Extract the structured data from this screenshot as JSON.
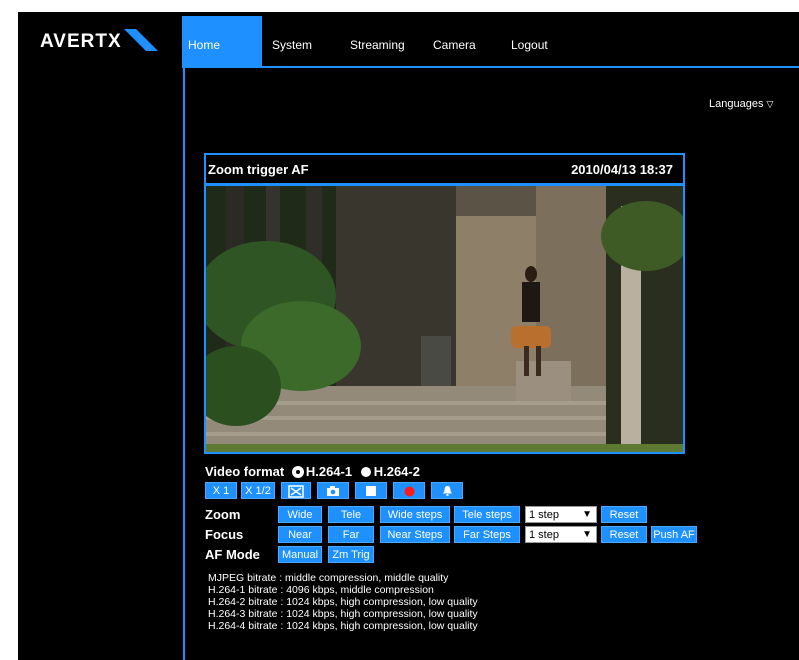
{
  "brand": {
    "logo_text": "AVERTX",
    "accent": "#1e90ff"
  },
  "nav": {
    "items": [
      {
        "label": "Home",
        "active": true
      },
      {
        "label": "System"
      },
      {
        "label": "Streaming"
      },
      {
        "label": "Camera"
      },
      {
        "label": "Logout"
      }
    ]
  },
  "languages": {
    "label": "Languages",
    "icon": "triangle-down-icon"
  },
  "viewer": {
    "title": "Zoom trigger AF",
    "timestamp": "2010/04/13 18:37"
  },
  "video_format": {
    "label": "Video format",
    "options": [
      {
        "label": "H.264-1",
        "selected": true
      },
      {
        "label": "H.264-2",
        "selected": false
      }
    ]
  },
  "toolbar": {
    "x1": "X 1",
    "x12": "X 1/2",
    "icons": [
      "fit-screen-icon",
      "snapshot-camera-icon",
      "stop-icon",
      "record-icon",
      "alarm-bell-icon"
    ]
  },
  "zoom": {
    "label": "Zoom",
    "wide": "Wide",
    "tele": "Tele",
    "wide_steps": "Wide steps",
    "tele_steps": "Tele steps",
    "step": "1 step",
    "reset": "Reset"
  },
  "focus": {
    "label": "Focus",
    "near": "Near",
    "far": "Far",
    "near_steps": "Near Steps",
    "far_steps": "Far Steps",
    "step": "1 step",
    "reset": "Reset",
    "push_af": "Push AF"
  },
  "af_mode": {
    "label": "AF Mode",
    "manual": "Manual",
    "zm_trig": "Zm Trig"
  },
  "bitrates": [
    "MJPEG bitrate : middle compression, middle quality",
    "H.264-1 bitrate : 4096 kbps, middle compression",
    "H.264-2 bitrate : 1024 kbps, high compression, low quality",
    "H.264-3 bitrate : 1024 kbps, high compression, low quality",
    "H.264-4 bitrate : 1024 kbps, high compression, low quality"
  ]
}
